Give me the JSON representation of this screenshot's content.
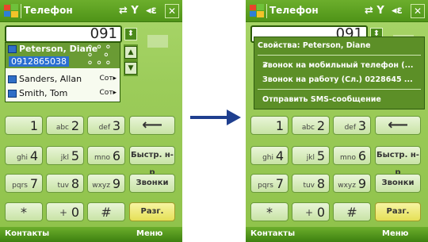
{
  "left": {
    "titlebar": {
      "title": "Телефон",
      "tray_signal": "⇄ Y",
      "tray_volume": "◂ε",
      "close": "✕"
    },
    "number_field": "091",
    "list": [
      {
        "name": "Peterson, Diane",
        "number": "0912865038",
        "selected": true
      },
      {
        "name": "Sanders, Allan",
        "tag": "Сот▸"
      },
      {
        "name": "Smith, Tom",
        "tag": "Сот▸"
      }
    ],
    "keypad": [
      {
        "digit": "1",
        "letters": ""
      },
      {
        "digit": "2",
        "letters": "abc"
      },
      {
        "digit": "3",
        "letters": "def"
      },
      {
        "digit": "4",
        "letters": "ghi"
      },
      {
        "digit": "5",
        "letters": "jkl"
      },
      {
        "digit": "6",
        "letters": "mno"
      },
      {
        "digit": "7",
        "letters": "pqrs"
      },
      {
        "digit": "8",
        "letters": "tuv"
      },
      {
        "digit": "9",
        "letters": "wxyz"
      },
      {
        "digit": "*",
        "letters": ""
      },
      {
        "digit": "0",
        "letters": "+"
      },
      {
        "digit": "#",
        "letters": ""
      }
    ],
    "func_keys": {
      "back": "⟵",
      "speed_dial": "Быстр. н-р",
      "calls": "Звонки",
      "talk": "Разг."
    },
    "softkeys": {
      "left": "Контакты",
      "right": "Меню"
    }
  },
  "right": {
    "titlebar": {
      "title": "Телефон",
      "tray_signal": "⇄ Y",
      "tray_volume": "◂ε",
      "close": "✕"
    },
    "number_field": "091",
    "menu": {
      "header": "Свойства: Peterson, Diane",
      "items": [
        "Звонок на мобильный телефон (...",
        "Звонок на работу (Сл.) 0228645 ...",
        "Отправить SMS-сообщение"
      ],
      "checked_index": 0
    },
    "keypad": [
      {
        "digit": "1",
        "letters": ""
      },
      {
        "digit": "2",
        "letters": "abc"
      },
      {
        "digit": "3",
        "letters": "def"
      },
      {
        "digit": "4",
        "letters": "ghi"
      },
      {
        "digit": "5",
        "letters": "jkl"
      },
      {
        "digit": "6",
        "letters": "mno"
      },
      {
        "digit": "7",
        "letters": "pqrs"
      },
      {
        "digit": "8",
        "letters": "tuv"
      },
      {
        "digit": "9",
        "letters": "wxyz"
      },
      {
        "digit": "*",
        "letters": ""
      },
      {
        "digit": "0",
        "letters": "+"
      },
      {
        "digit": "#",
        "letters": ""
      }
    ],
    "func_keys": {
      "back": "⟵",
      "speed_dial": "Быстр. н-р",
      "calls": "Звонки",
      "talk": "Разг."
    },
    "softkeys": {
      "left": "Контакты",
      "right": "Меню"
    }
  },
  "colors": {
    "accent": "#4f9418",
    "arrow": "#1f3f8f",
    "talk": "#e5e057"
  },
  "icons": {
    "logo": "windows-flag-icon",
    "close": "close-icon",
    "arrow": "right-arrow-icon"
  }
}
